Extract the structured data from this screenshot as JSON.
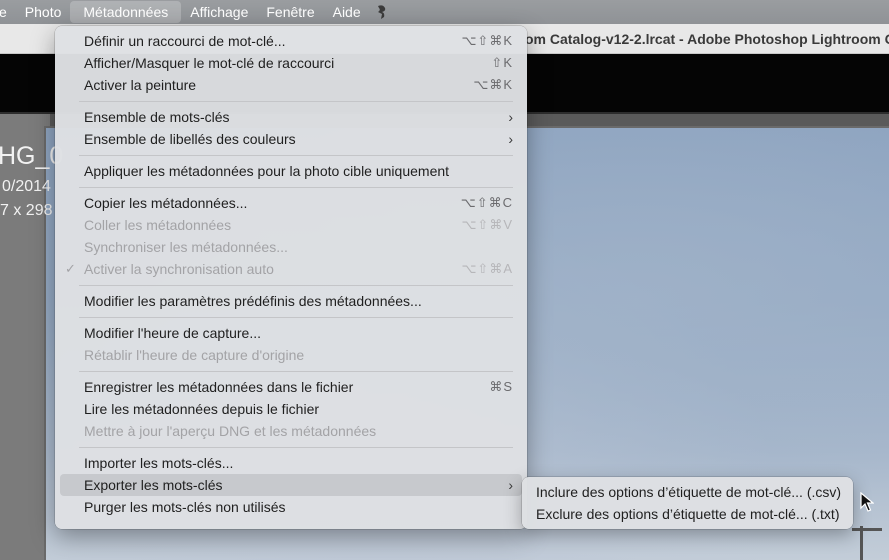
{
  "menubar": {
    "items": [
      {
        "label": "e"
      },
      {
        "label": "Photo"
      },
      {
        "label": "Métadonnées"
      },
      {
        "label": "Affichage"
      },
      {
        "label": "Fenêtre"
      },
      {
        "label": "Aide"
      }
    ],
    "extra_icon": "script-icon"
  },
  "window": {
    "title": "om Catalog-v12-2.lrcat - Adobe Photoshop Lightroom Cl"
  },
  "photo_overlay": {
    "filename": "HG_0",
    "date": "0/2014",
    "dimensions": "7 x 298"
  },
  "menu": {
    "items": [
      {
        "label": "Définir un raccourci de mot-clé...",
        "shortcut": "⌥⇧⌘K"
      },
      {
        "label": "Afficher/Masquer le mot-clé de raccourci",
        "shortcut": "⇧K"
      },
      {
        "label": "Activer la peinture",
        "shortcut": "⌥⌘K"
      },
      {
        "label": "Ensemble de mots-clés",
        "submenu": true
      },
      {
        "label": "Ensemble de libellés des couleurs",
        "submenu": true
      },
      {
        "label": "Appliquer les métadonnées pour la photo cible uniquement"
      },
      {
        "label": "Copier les métadonnées...",
        "shortcut": "⌥⇧⌘C"
      },
      {
        "label": "Coller les métadonnées",
        "shortcut": "⌥⇧⌘V",
        "disabled": true
      },
      {
        "label": "Synchroniser les métadonnées...",
        "disabled": true
      },
      {
        "label": "Activer la synchronisation auto",
        "shortcut": "⌥⇧⌘A",
        "disabled": true,
        "checked": true
      },
      {
        "label": "Modifier les paramètres prédéfinis des métadonnées..."
      },
      {
        "label": "Modifier l'heure de capture..."
      },
      {
        "label": "Rétablir l'heure de capture d'origine",
        "disabled": true
      },
      {
        "label": "Enregistrer les métadonnées dans le fichier",
        "shortcut": "⌘S"
      },
      {
        "label": "Lire les métadonnées depuis le fichier"
      },
      {
        "label": "Mettre à jour l'aperçu DNG et les métadonnées",
        "disabled": true
      },
      {
        "label": "Importer les mots-clés..."
      },
      {
        "label": "Exporter les mots-clés",
        "submenu": true,
        "highlighted": true
      },
      {
        "label": "Purger les mots-clés non utilisés"
      }
    ],
    "check_mark": "✓",
    "chevron": "›"
  },
  "submenu": {
    "items": [
      {
        "label": "Inclure des options d’étiquette de mot-clé... (.csv)"
      },
      {
        "label": "Exclure des options d’étiquette de mot-clé... (.txt)"
      }
    ]
  }
}
